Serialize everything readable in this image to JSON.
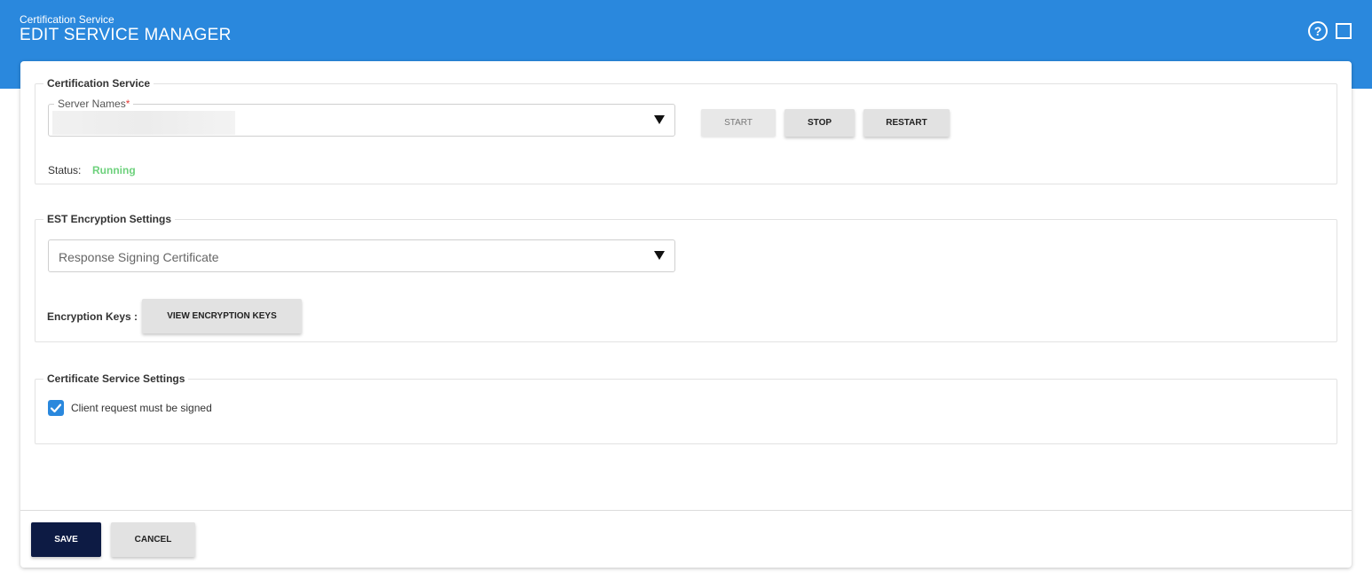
{
  "header": {
    "subtitle": "Certification Service",
    "title": "EDIT SERVICE MANAGER",
    "help_icon": "help-circle-icon",
    "maximize_icon": "maximize-icon",
    "background_color": "#2a88dd"
  },
  "certification_service": {
    "legend": "Certification Service",
    "server_names": {
      "label": "Server Names",
      "required_marker": "*",
      "value": ""
    },
    "buttons": {
      "start": "START",
      "stop": "STOP",
      "restart": "RESTART"
    },
    "status_label": "Status:",
    "status_value": "Running",
    "status_color": "#6dd17c"
  },
  "est_encryption": {
    "legend": "EST Encryption Settings",
    "signing_certificate_placeholder": "Response Signing Certificate",
    "encryption_keys_label": "Encryption Keys :",
    "view_keys_button": "VIEW ENCRYPTION KEYS"
  },
  "certificate_service_settings": {
    "legend": "Certificate Service Settings",
    "client_signed": {
      "label": "Client request must be signed",
      "checked": true
    }
  },
  "footer": {
    "save": "SAVE",
    "cancel": "CANCEL",
    "save_color": "#0d1b44"
  }
}
